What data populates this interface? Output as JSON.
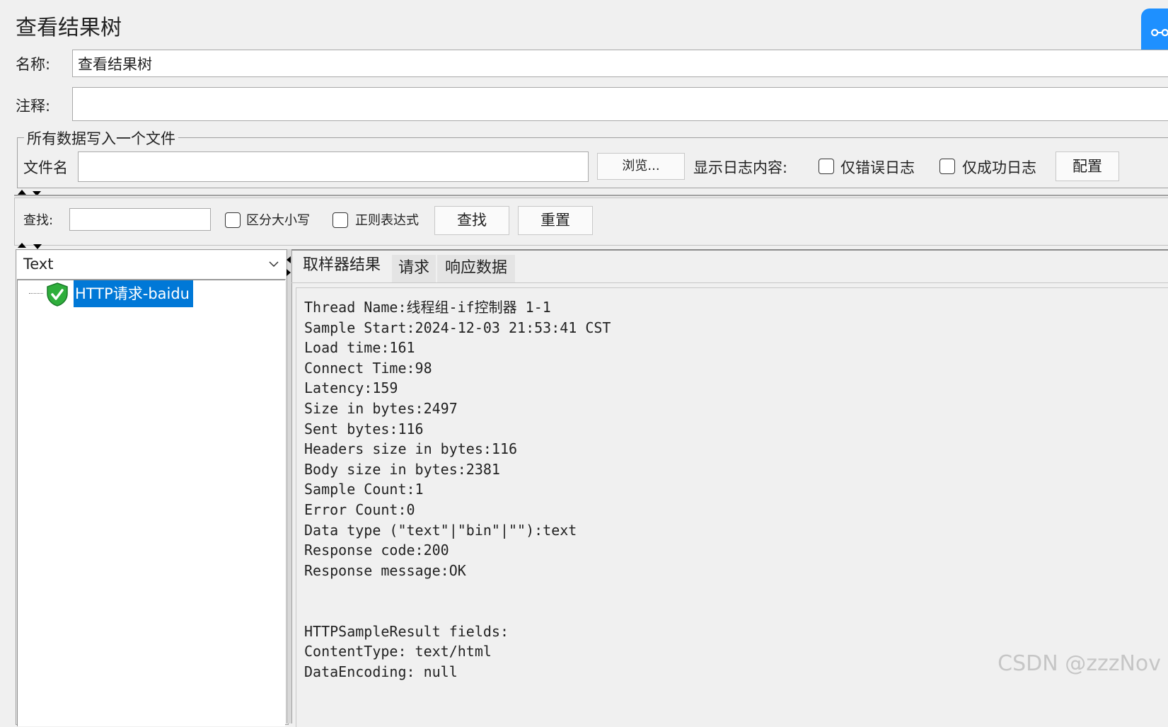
{
  "title": "查看结果树",
  "name_label": "名称:",
  "name_value": "查看结果树",
  "comment_label": "注释:",
  "comment_value": "",
  "file_section": {
    "legend": "所有数据写入一个文件",
    "filename_label": "文件名",
    "filename_value": "",
    "browse_label": "浏览...",
    "log_label": "显示日志内容:",
    "errors_only_label": "仅错误日志",
    "success_only_label": "仅成功日志",
    "configure_label": "配置"
  },
  "search": {
    "label": "查找:",
    "value": "",
    "case_sensitive_label": "区分大小写",
    "regex_label": "正则表达式",
    "find_button": "查找",
    "reset_button": "重置"
  },
  "renderer": {
    "selected": "Text"
  },
  "tree": {
    "items": [
      {
        "label": "HTTP请求-baidu",
        "status": "success"
      }
    ]
  },
  "tabs": [
    {
      "label": "取样器结果"
    },
    {
      "label": "请求"
    },
    {
      "label": "响应数据"
    }
  ],
  "result_lines": [
    "Thread Name:线程组-if控制器 1-1",
    "Sample Start:2024-12-03 21:53:41 CST",
    "Load time:161",
    "Connect Time:98",
    "Latency:159",
    "Size in bytes:2497",
    "Sent bytes:116",
    "Headers size in bytes:116",
    "Body size in bytes:2381",
    "Sample Count:1",
    "Error Count:0",
    "Data type (\"text\"|\"bin\"|\"\"):text",
    "Response code:200",
    "Response message:OK",
    "",
    "",
    "HTTPSampleResult fields:",
    "ContentType: text/html",
    "DataEncoding: null"
  ],
  "watermark": "CSDN @zzzNov",
  "colors": {
    "selection": "#0078d7",
    "success": "#1fa83a"
  },
  "icons": {
    "link": "link-icon",
    "tree_success": "shield-check-icon",
    "dropdown": "chevron-down-icon"
  }
}
